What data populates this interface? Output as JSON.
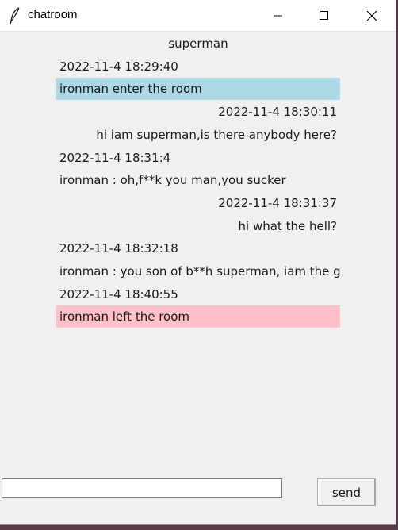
{
  "window": {
    "title": "chatroom"
  },
  "messages": [
    {
      "text": "superman",
      "align": "center",
      "style": "plain"
    },
    {
      "text": "2022-11-4 18:29:40",
      "align": "left",
      "style": "plain"
    },
    {
      "text": "ironman enter the room",
      "align": "left",
      "style": "enter",
      "bg": "#add8e6"
    },
    {
      "text": "2022-11-4 18:30:11",
      "align": "right",
      "style": "plain"
    },
    {
      "text": "hi iam superman,is there anybody here?",
      "align": "right",
      "style": "plain"
    },
    {
      "text": "2022-11-4 18:31:4",
      "align": "left",
      "style": "plain"
    },
    {
      "text": "ironman : oh,f**k you man,you sucker",
      "align": "left",
      "style": "plain"
    },
    {
      "text": "2022-11-4 18:31:37",
      "align": "right",
      "style": "plain"
    },
    {
      "text": "hi what the hell?",
      "align": "right",
      "style": "plain"
    },
    {
      "text": "2022-11-4 18:32:18",
      "align": "left",
      "style": "plain"
    },
    {
      "text": "ironman : you son of b**h superman, iam the go",
      "align": "left",
      "style": "plain"
    },
    {
      "text": "2022-11-4 18:40:55",
      "align": "left",
      "style": "plain"
    },
    {
      "text": "ironman left the room",
      "align": "left",
      "style": "leave",
      "bg": "#ffc0cb"
    }
  ],
  "input": {
    "value": "",
    "placeholder": ""
  },
  "send_button": {
    "label": "send"
  },
  "icons": {
    "app": "feather-icon",
    "minimize": "minimize-icon",
    "maximize": "maximize-icon",
    "close": "close-icon"
  }
}
